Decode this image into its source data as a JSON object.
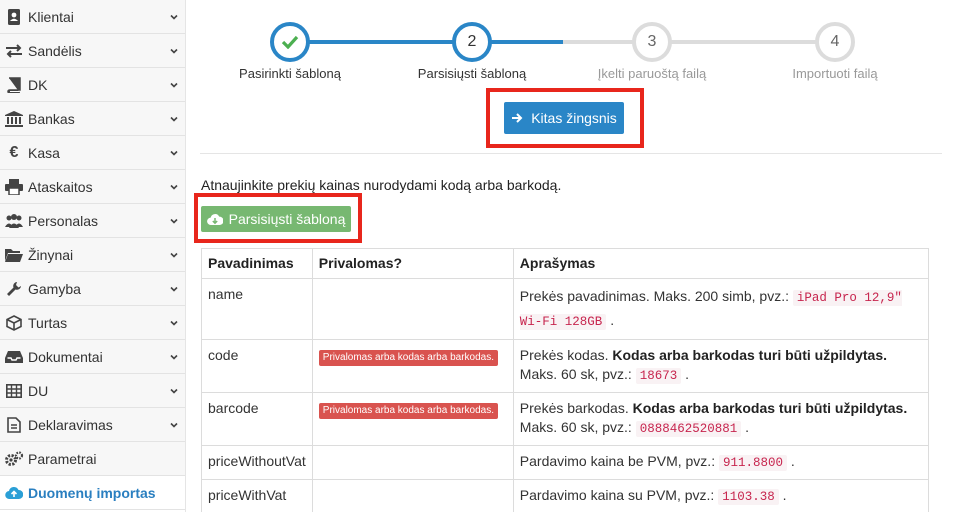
{
  "sidebar": {
    "items": [
      {
        "label": "Klientai",
        "icon": "contacts-book-icon"
      },
      {
        "label": "Sandėlis",
        "icon": "exchange-arrows-icon"
      },
      {
        "label": "DK",
        "icon": "book-icon"
      },
      {
        "label": "Bankas",
        "icon": "bank-icon"
      },
      {
        "label": "Kasa",
        "icon": "euro-icon"
      },
      {
        "label": "Ataskaitos",
        "icon": "printer-icon"
      },
      {
        "label": "Personalas",
        "icon": "users-icon"
      },
      {
        "label": "Žinynai",
        "icon": "folder-open-icon"
      },
      {
        "label": "Gamyba",
        "icon": "wrench-icon"
      },
      {
        "label": "Turtas",
        "icon": "cube-icon"
      },
      {
        "label": "Dokumentai",
        "icon": "inbox-icon"
      },
      {
        "label": "DU",
        "icon": "table-grid-icon"
      },
      {
        "label": "Deklaravimas",
        "icon": "file-text-icon"
      },
      {
        "label": "Parametrai",
        "icon": "cogs-icon"
      },
      {
        "label": "Duomenų importas",
        "icon": "cloud-upload-icon",
        "active": true
      }
    ]
  },
  "stepper": {
    "steps": [
      {
        "number": "✓",
        "label": "Pasirinkti šabloną",
        "state": "done"
      },
      {
        "number": "2",
        "label": "Parsisiųsti šabloną",
        "state": "current"
      },
      {
        "number": "3",
        "label": "Įkelti paruoštą failą",
        "state": "pending"
      },
      {
        "number": "4",
        "label": "Importuoti failą",
        "state": "pending"
      }
    ]
  },
  "next_button": {
    "label": "Kitas žingsnis"
  },
  "intro_text": "Atnaujinkite prekių kainas nurodydami kodą arba barkodą.",
  "download_button": {
    "label": "Parsisiųsti šabloną"
  },
  "table": {
    "headers": [
      "Pavadinimas",
      "Privalomas?",
      "Aprašymas"
    ],
    "rows": [
      {
        "name": "name",
        "required": "",
        "desc_pre": "Prekės pavadinimas. Maks. 200 simb, pvz.: ",
        "desc_bold": "",
        "desc_mid": "",
        "example": "iPad Pro 12,9\" Wi-Fi 128GB",
        "desc_post": "."
      },
      {
        "name": "code",
        "required": "Privalomas arba kodas arba barkodas.",
        "desc_pre": "Prekės kodas. ",
        "desc_bold": "Kodas arba barkodas turi būti užpildytas.",
        "desc_mid": " Maks. 60 sk, pvz.: ",
        "example": "18673",
        "desc_post": "."
      },
      {
        "name": "barcode",
        "required": "Privalomas arba kodas arba barkodas.",
        "desc_pre": "Prekės barkodas. ",
        "desc_bold": "Kodas arba barkodas turi būti užpildytas.",
        "desc_mid": " Maks. 60 sk, pvz.: ",
        "example": "0888462520881",
        "desc_post": "."
      },
      {
        "name": "priceWithoutVat",
        "required": "",
        "desc_pre": "Pardavimo kaina be PVM, pvz.: ",
        "desc_bold": "",
        "desc_mid": "",
        "example": "911.8800",
        "desc_post": "."
      },
      {
        "name": "priceWithVat",
        "required": "",
        "desc_pre": "Pardavimo kaina su PVM, pvz.: ",
        "desc_bold": "",
        "desc_mid": "",
        "example": "1103.38",
        "desc_post": "."
      }
    ]
  },
  "colors": {
    "accent": "#2a86c7",
    "done_green": "#4caf50",
    "download_green": "#77b871",
    "required_red": "#d9534f",
    "highlight_red": "#e8261c"
  }
}
